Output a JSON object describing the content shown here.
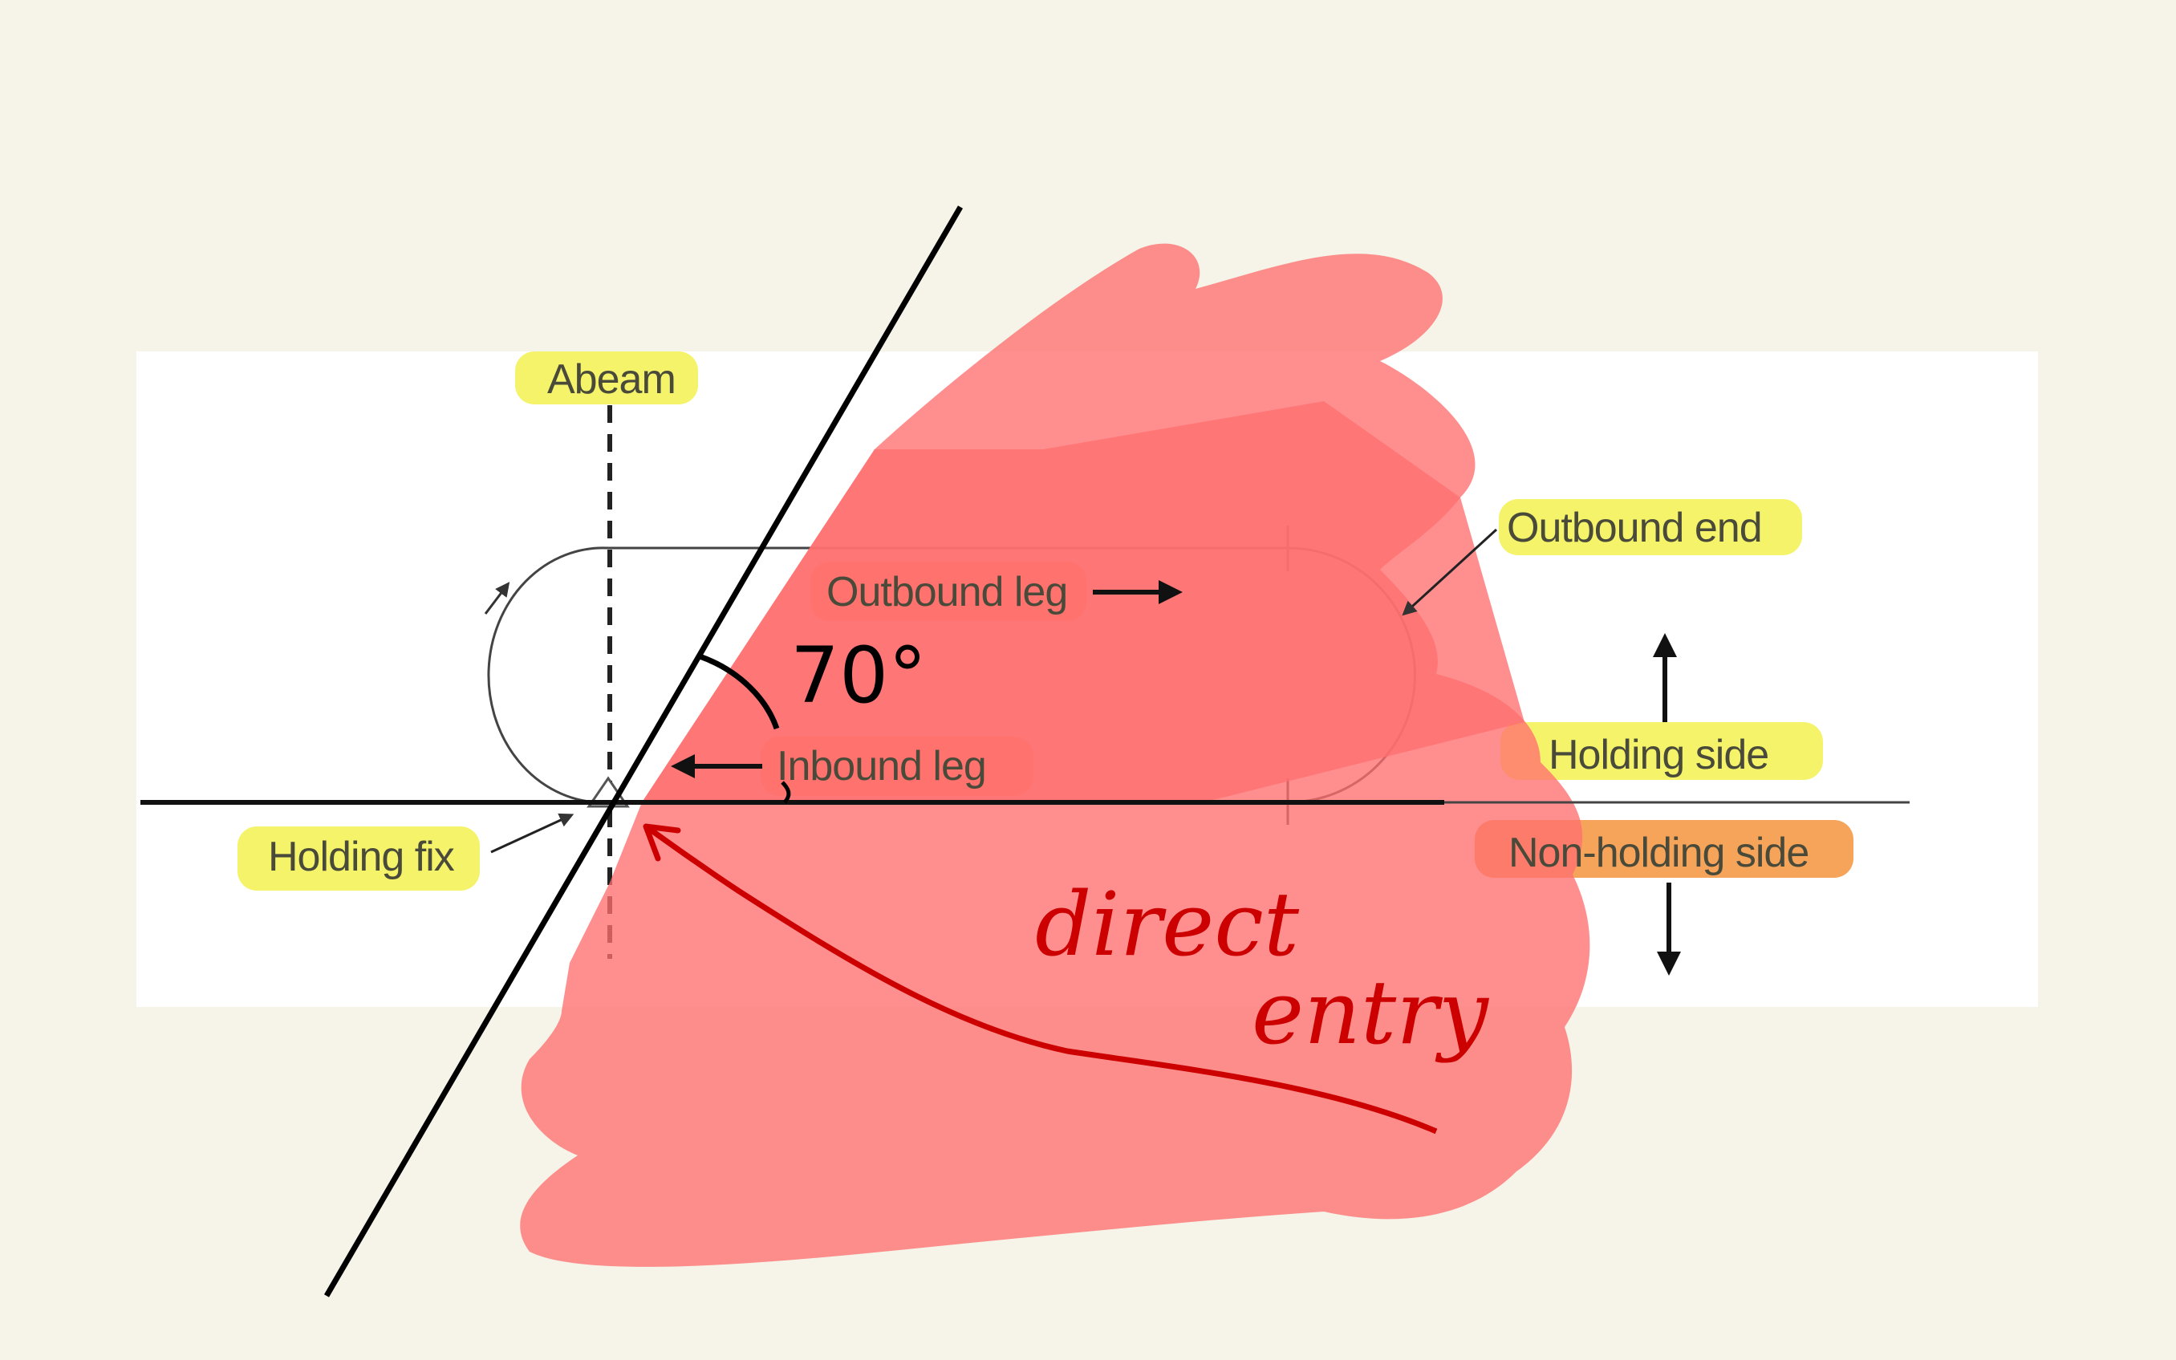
{
  "diagram": {
    "labels": {
      "abeam": "Abeam",
      "outbound_end": "Outbound end",
      "outbound_leg": "Outbound leg",
      "inbound_leg": "Inbound leg",
      "holding_side": "Holding side",
      "non_holding_side": "Non-holding side",
      "holding_fix": "Holding fix"
    },
    "annotations": {
      "angle": "70°",
      "entry_line1": "direct",
      "entry_line2": "entry"
    },
    "colors": {
      "background": "#f6f4e8",
      "panel": "#ffffff",
      "highlight_yellow": "#f4f36a",
      "highlight_orange": "#f7a45b",
      "sector_fill": "#ff6f6f",
      "handwriting_red": "#cc0000",
      "ink": "#000000"
    }
  }
}
